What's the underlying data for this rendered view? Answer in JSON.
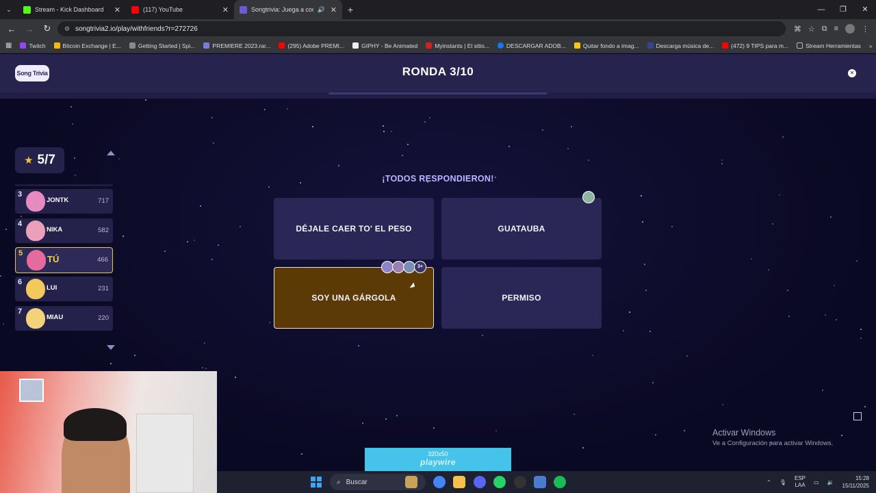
{
  "browser": {
    "tabs": [
      {
        "label": "Stream - Kick Dashboard",
        "color": "#53fc18",
        "active": false
      },
      {
        "label": "(117) YouTube",
        "color": "#ff0000",
        "active": false
      },
      {
        "label": "Songtrivia: Juega a concurs",
        "color": "#6b5bd2",
        "active": true
      }
    ],
    "url": "songtrivia2.io/play/withfriends?r=272726",
    "bookmarks": [
      {
        "label": "Twitch",
        "color": "#9146ff"
      },
      {
        "label": "Bitcoin Exchange | E...",
        "color": "#f0b90b"
      },
      {
        "label": "Getting Started | Spi...",
        "color": "#888888"
      },
      {
        "label": "PREMIERE 2023.rar...",
        "color": "#7b7bd8"
      },
      {
        "label": "(295) Adobe PREMI...",
        "color": "#ff0000"
      },
      {
        "label": "GIPHY - Be Animated",
        "color": "#eeeeee"
      },
      {
        "label": "Myinstants | El sitio...",
        "color": "#cc2222"
      },
      {
        "label": "DESCARGAR ADOB...",
        "color": "#1877f2"
      },
      {
        "label": "Quitar fondo a imag...",
        "color": "#f5c518"
      },
      {
        "label": "Descarga música de...",
        "color": "#334499"
      },
      {
        "label": "(472) 9 TIPS para m...",
        "color": "#ff0000"
      },
      {
        "label": "Stream Herramientas",
        "color": "#bbbbbb"
      }
    ]
  },
  "game": {
    "logo": "Song Trivia",
    "round": "RONDA 3/10",
    "score": "5/7",
    "status": "¡TODOS RESPONDIERON!",
    "leaderboard": [
      {
        "rank": "3",
        "name": "JONTK",
        "points": "717",
        "me": false,
        "avatar": "#e58bc2"
      },
      {
        "rank": "4",
        "name": "NIKA",
        "points": "582",
        "me": false,
        "avatar": "#e9a0b8"
      },
      {
        "rank": "5",
        "name": "TÚ",
        "points": "466",
        "me": true,
        "avatar": "#e56b9c"
      },
      {
        "rank": "6",
        "name": "LUI",
        "points": "231",
        "me": false,
        "avatar": "#f2c95a"
      },
      {
        "rank": "7",
        "name": "MIAU",
        "points": "220",
        "me": false,
        "avatar": "#f3d27a"
      }
    ],
    "answers": [
      {
        "label": "DÉJALE CAER TO' EL PESO",
        "selected": false
      },
      {
        "label": "GUATAUBA",
        "selected": false
      },
      {
        "label": "SOY UNA GÁRGOLA",
        "selected": true
      },
      {
        "label": "PERMISO",
        "selected": false
      }
    ],
    "more_players": "3+",
    "ad_size": "320x50",
    "ad_brand": "playwire"
  },
  "windows": {
    "activate_title": "Activar Windows",
    "activate_sub": "Ve a Configuración para activar Windows.",
    "search": "Buscar",
    "lang": "ESP",
    "lang_region": "LAA",
    "time": "15:28",
    "date": "15/11/2025"
  }
}
